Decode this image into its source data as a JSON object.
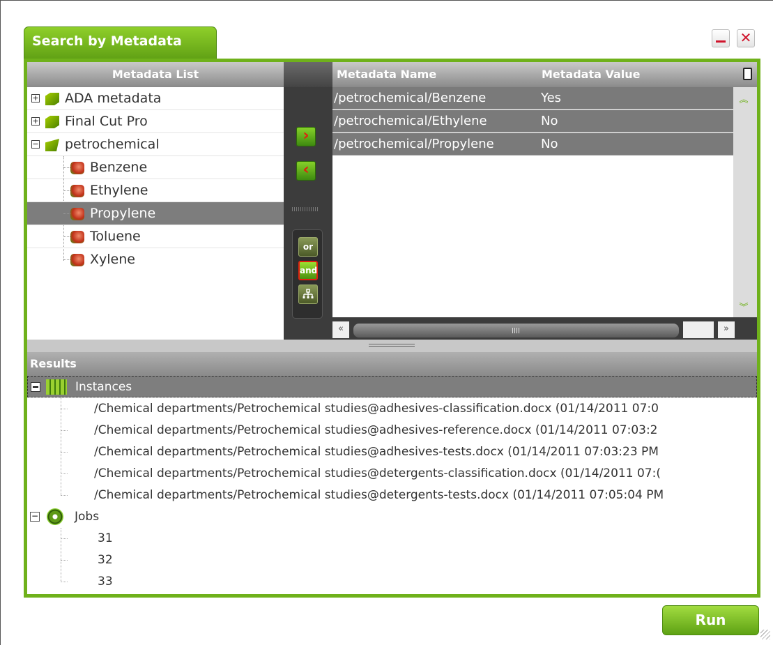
{
  "window": {
    "tab_title": "Search by Metadata",
    "minimize_symbol": "—",
    "close_symbol": "✕"
  },
  "metadata_list": {
    "header": "Metadata List",
    "items": [
      {
        "label": "ADA metadata",
        "expander": "+",
        "icon": "folder-icon"
      },
      {
        "label": "Final Cut Pro",
        "expander": "+",
        "icon": "folder-icon"
      },
      {
        "label": "petrochemical",
        "expander": "−",
        "icon": "open-folder-icon"
      },
      {
        "label": "Benzene",
        "icon": "metadata-field-icon"
      },
      {
        "label": "Ethylene",
        "icon": "metadata-field-icon"
      },
      {
        "label": "Propylene",
        "icon": "metadata-field-icon",
        "selected": true
      },
      {
        "label": "Toluene",
        "icon": "metadata-field-icon"
      },
      {
        "label": "Xylene",
        "icon": "metadata-field-icon"
      }
    ]
  },
  "controls": {
    "add_symbol": "›",
    "remove_symbol": "‹",
    "or_label": "or",
    "and_label": "and",
    "hierarchy_icon": "hierarchy-icon"
  },
  "selected_metadata": {
    "col_name": "Metadata Name",
    "col_value": "Metadata Value",
    "rows": [
      {
        "name": "/petrochemical/Benzene",
        "value": "Yes"
      },
      {
        "name": "/petrochemical/Ethylene",
        "value": "No"
      },
      {
        "name": "/petrochemical/Propylene",
        "value": "No"
      }
    ],
    "scroll_up": "︽",
    "scroll_down": "︾",
    "scroll_left": "«",
    "scroll_right": "»"
  },
  "results": {
    "header": "Results",
    "instances_label": "Instances",
    "instances": [
      "/Chemical departments/Petrochemical studies@adhesives-classification.docx (01/14/2011 07:0",
      "/Chemical departments/Petrochemical studies@adhesives-reference.docx (01/14/2011 07:03:2",
      "/Chemical departments/Petrochemical studies@adhesives-tests.docx (01/14/2011 07:03:23 PM",
      "/Chemical departments/Petrochemical studies@detergents-classification.docx (01/14/2011 07:(",
      "/Chemical departments/Petrochemical studies@detergents-tests.docx (01/14/2011 07:05:04 PM"
    ],
    "jobs_label": "Jobs",
    "jobs_expander": "−",
    "jobs": [
      "31",
      "32",
      "33"
    ]
  },
  "footer": {
    "run_label": "Run"
  },
  "colors": {
    "accent": "#6fb11b",
    "header_gray": "#8a8a8a",
    "selection_gray": "#7d7d7d",
    "dark_panel": "#3c3c3c"
  }
}
